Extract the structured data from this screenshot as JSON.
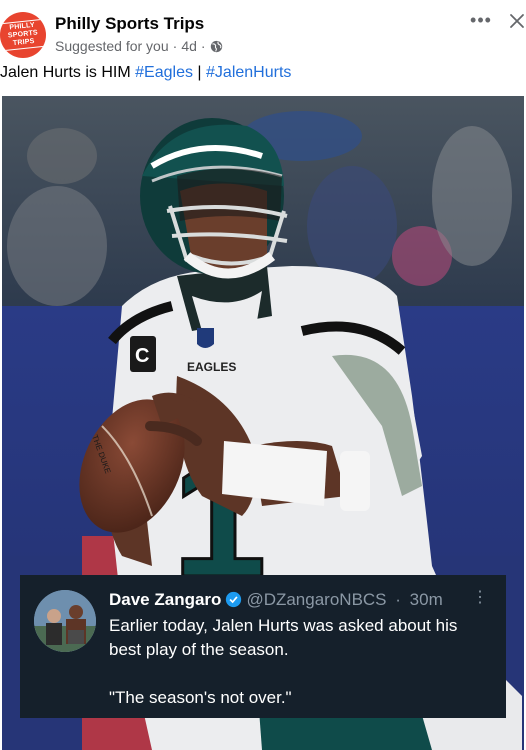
{
  "post": {
    "page_name": "Philly Sports Trips",
    "avatar_text": "PHILLY SPORTS TRIPS",
    "suggested": "Suggested for you",
    "separator": "·",
    "time": "4d",
    "separator2": "·",
    "privacy_icon": "globe-icon",
    "more_icon": "more-horizontal-icon",
    "close_icon": "close-icon",
    "caption_text": "Jalen Hurts is HIM ",
    "caption_tag1": "#Eagles",
    "caption_sep": " | ",
    "caption_tag2": "#JalenHurts"
  },
  "image": {
    "jersey_number": "1",
    "jersey_text": "EAGLES",
    "captain_patch": "C",
    "ball_text": "THE DUKE"
  },
  "tweet": {
    "name": "Dave Zangaro",
    "handle": "@DZangaroNBCS",
    "sep": "·",
    "time": "30m",
    "dots": "⋮",
    "line1": "Earlier today, Jalen Hurts was asked about his best play of the season.",
    "line2": "\"The season's not over.\""
  },
  "colors": {
    "link": "#216fdb",
    "tweet_bg": "#15202b",
    "verified": "#1d9bf0",
    "avatar_bg": "#e8442f"
  }
}
